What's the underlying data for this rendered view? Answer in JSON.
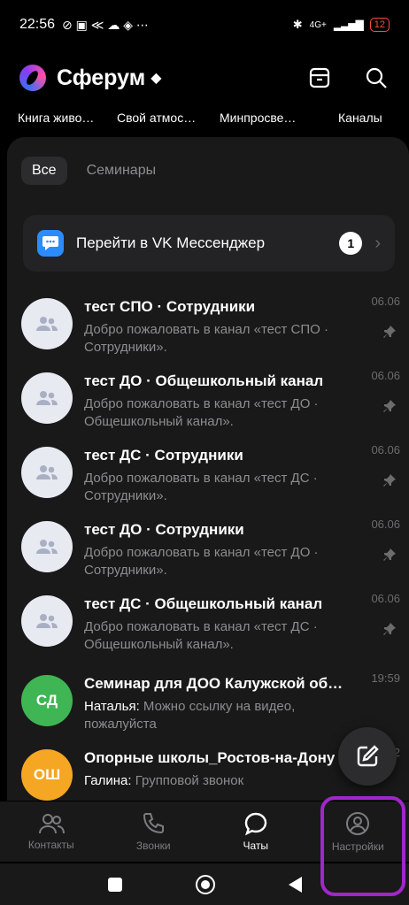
{
  "status": {
    "time": "22:56",
    "battery": "12",
    "network": "4G+"
  },
  "app": {
    "title": "Сферум"
  },
  "folders": [
    "Книга живо…",
    "Свой атмос…",
    "Минпросве…",
    "Каналы"
  ],
  "filters": [
    "Все",
    "Семинары"
  ],
  "promo": {
    "label": "Перейти в VK Мессенджер",
    "badge": "1"
  },
  "chats": [
    {
      "name": "тест СПО · Сотрудники",
      "message": "Добро пожаловать в канал «тест СПО · Сотрудники».",
      "time": "06.06",
      "pinned": true
    },
    {
      "name": "тест ДО · Общешкольный канал",
      "message": "Добро пожаловать в канал «тест ДО · Общешкольный канал».",
      "time": "06.06",
      "pinned": true
    },
    {
      "name": "тест ДС · Сотрудники",
      "message": "Добро пожаловать в канал «тест ДС · Сотрудники».",
      "time": "06.06",
      "pinned": true
    },
    {
      "name": "тест ДО · Сотрудники",
      "message": "Добро пожаловать в канал «тест ДО · Сотрудники».",
      "time": "06.06",
      "pinned": true
    },
    {
      "name": "тест ДС · Общешкольный канал",
      "message": "Добро пожаловать в канал «тест ДС · Общешкольный канал».",
      "time": "06.06",
      "pinned": true
    },
    {
      "name": "Семинар для ДОО Калужской об…",
      "sender": "Наталья:",
      "message": "Можно ссылку на видео, пожалуйста",
      "time": "19:59",
      "initials": "СД"
    },
    {
      "name": "Опорные школы_Ростов-на-Дону",
      "sender": "Галина:",
      "message": "Групповой звонок",
      "time": "2",
      "initials": "ОШ"
    }
  ],
  "tabs": [
    {
      "label": "Контакты"
    },
    {
      "label": "Звонки"
    },
    {
      "label": "Чаты",
      "active": true
    },
    {
      "label": "Настройки"
    }
  ],
  "colors": {
    "accent": "#2b8cff",
    "highlight": "#a027c9",
    "avatar_green": "#3fb653",
    "avatar_orange": "#f5a623"
  }
}
